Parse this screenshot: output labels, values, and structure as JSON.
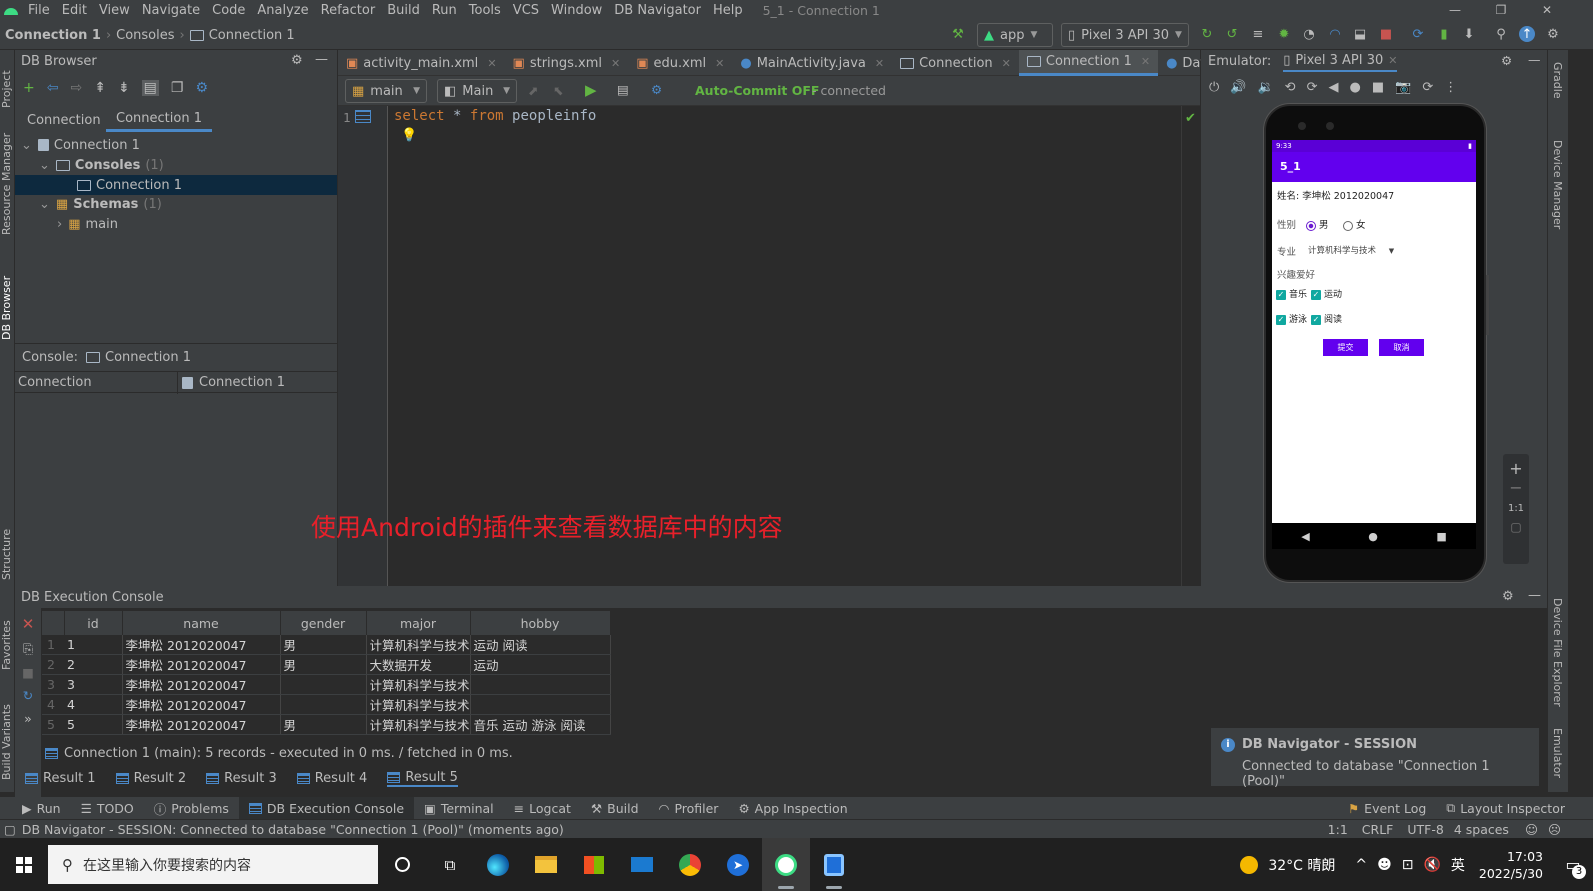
{
  "menubar": {
    "items": [
      "File",
      "Edit",
      "View",
      "Navigate",
      "Code",
      "Analyze",
      "Refactor",
      "Build",
      "Run",
      "Tools",
      "VCS",
      "Window",
      "DB Navigator",
      "Help"
    ],
    "window_title": "5_1 - Connection 1"
  },
  "navbar": {
    "crumbs": [
      "Connection 1",
      "Consoles",
      "Connection 1"
    ]
  },
  "toolbar": {
    "run_config": "app",
    "device": "Pixel 3 API 30"
  },
  "db_browser": {
    "title": "DB Browser",
    "tabs": [
      "Connection",
      "Connection 1"
    ],
    "tree": {
      "connection": "Connection 1",
      "consoles": "Consoles",
      "consoles_count": "(1)",
      "console_item": "Connection 1",
      "schemas": "Schemas",
      "schemas_count": "(1)",
      "schema_main": "main"
    },
    "console_label": "Console:",
    "console_value": "Connection 1",
    "footer_left": "Connection",
    "footer_right": "Connection 1"
  },
  "editor": {
    "tabs": [
      {
        "label": "activity_main.xml",
        "active": false
      },
      {
        "label": "strings.xml",
        "active": false
      },
      {
        "label": "edu.xml",
        "active": false
      },
      {
        "label": "MainActivity.java",
        "active": false
      },
      {
        "label": "Connection",
        "active": false
      },
      {
        "label": "Connection 1",
        "active": true
      },
      {
        "label": "Database.java",
        "active": false
      }
    ],
    "schema_combo": "main",
    "session_combo": "Main",
    "autocommit": "Auto-Commit OFF",
    "conn_status": "- connected",
    "line_number": "1",
    "code": {
      "kw1": "select",
      "star": "*",
      "kw2": "from",
      "table": "peopleinfo"
    }
  },
  "emulator": {
    "label": "Emulator:",
    "device_tab": "Pixel 3 API 30",
    "zoom_ratio": "1:1",
    "app": {
      "status_time": "9:33",
      "title": "5_1",
      "name_line": "姓名: 李坤松 2012020047",
      "gender_label": "性别",
      "gender_male": "男",
      "gender_female": "女",
      "major_label": "专业",
      "major_value": "计算机科学与技术",
      "hobby_label": "兴趣爱好",
      "hobbies": [
        "音乐",
        "运动",
        "游泳",
        "阅读"
      ],
      "btn_submit": "提交",
      "btn_cancel": "取消"
    }
  },
  "overlay_caption": "使用Android的插件来查看数据库中的内容",
  "console": {
    "title": "DB Execution Console",
    "columns": [
      "id",
      "name",
      "gender",
      "major",
      "hobby"
    ],
    "rows": [
      {
        "rn": "1",
        "id": "1",
        "name": "李坤松 2012020047",
        "gender": "男",
        "major": "计算机科学与技术",
        "hobby": "运动 阅读"
      },
      {
        "rn": "2",
        "id": "2",
        "name": "李坤松 2012020047",
        "gender": "男",
        "major": "大数据开发",
        "hobby": "运动"
      },
      {
        "rn": "3",
        "id": "3",
        "name": "李坤松 2012020047",
        "gender": "",
        "major": "计算机科学与技术",
        "hobby": ""
      },
      {
        "rn": "4",
        "id": "4",
        "name": "李坤松 2012020047",
        "gender": "",
        "major": "计算机科学与技术",
        "hobby": ""
      },
      {
        "rn": "5",
        "id": "5",
        "name": "李坤松 2012020047",
        "gender": "男",
        "major": "计算机科学与技术",
        "hobby": "音乐 运动 游泳 阅读"
      }
    ],
    "status": "Connection 1 (main): 5 records   - executed in 0 ms. / fetched in 0 ms.",
    "result_tabs": [
      "Result 1",
      "Result 2",
      "Result 3",
      "Result 4",
      "Result 5"
    ]
  },
  "notification": {
    "title": "DB Navigator - SESSION",
    "body": "Connected to database \"Connection 1 (Pool)\""
  },
  "bottom_tools": [
    "Run",
    "TODO",
    "Problems",
    "DB Execution Console",
    "Terminal",
    "Logcat",
    "Build",
    "Profiler",
    "App Inspection"
  ],
  "bottom_tools_right": [
    "Event Log",
    "Layout Inspector"
  ],
  "statusbar": {
    "message": "DB Navigator - SESSION: Connected to database \"Connection 1 (Pool)\" (moments ago)",
    "position": "1:1",
    "line_sep": "CRLF",
    "encoding": "UTF-8",
    "indent": "4 spaces"
  },
  "left_strip": [
    "Project",
    "Resource Manager",
    "DB Browser",
    "Structure",
    "Favorites",
    "Build Variants"
  ],
  "right_strip": [
    "Gradle",
    "Device Manager",
    "Device File Explorer",
    "Emulator"
  ],
  "taskbar": {
    "search_placeholder": "在这里输入你要搜索的内容",
    "weather": "32°C 晴朗",
    "ime": "英",
    "time": "17:03",
    "date": "2022/5/30",
    "notif_count": "3"
  }
}
